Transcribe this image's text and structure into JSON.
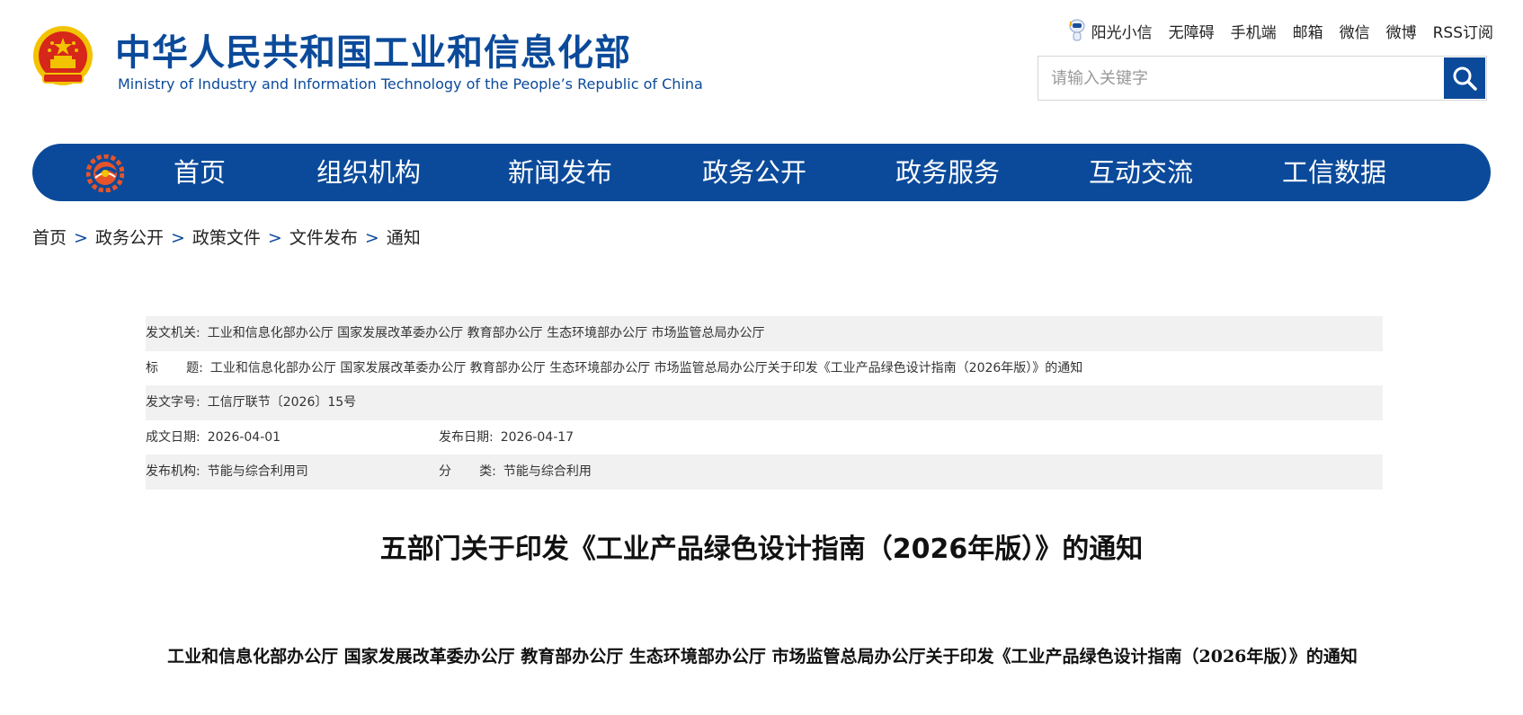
{
  "header": {
    "site_title": "中华人民共和国工业和信息化部",
    "site_subtitle": "Ministry of Industry and Information Technology of the People’s Republic of China",
    "emblem_icon": "national-emblem-icon",
    "top_links": [
      "阳光小信",
      "无障碍",
      "手机端",
      "邮箱",
      "微信",
      "微博",
      "RSS订阅"
    ],
    "search": {
      "placeholder": "请输入关键字",
      "button_icon": "search-icon"
    }
  },
  "nav": {
    "logo_icon": "miit-gear-logo-icon",
    "items": [
      "首页",
      "组织机构",
      "新闻发布",
      "政务公开",
      "政务服务",
      "互动交流",
      "工信数据"
    ]
  },
  "breadcrumb": {
    "items": [
      "首页",
      "政务公开",
      "政策文件",
      "文件发布",
      "通知"
    ],
    "separator": ">"
  },
  "metadata": {
    "issuer": {
      "label": "发文机关:",
      "value": "工业和信息化部办公厅 国家发展改革委办公厅 教育部办公厅 生态环境部办公厅 市场监管总局办公厅"
    },
    "title": {
      "label": "标       题:",
      "value": "工业和信息化部办公厅 国家发展改革委办公厅 教育部办公厅 生态环境部办公厅 市场监管总局办公厅关于印发《工业产品绿色设计指南（2026年版）》的通知"
    },
    "doc_number": {
      "label": "发文字号:",
      "value": "工信厅联节〔2026〕15号"
    },
    "written_date": {
      "label": "成文日期:",
      "value": "2026-04-01"
    },
    "publish_date": {
      "label": "发布日期:",
      "value": "2026-04-17"
    },
    "publisher": {
      "label": "发布机构:",
      "value": "节能与综合利用司"
    },
    "category": {
      "label": "分       类:",
      "value": "节能与综合利用"
    }
  },
  "article": {
    "title": "五部门关于印发《工业产品绿色设计指南（2026年版）》的通知",
    "subtitle": "工业和信息化部办公厅 国家发展改革委办公厅 教育部办公厅 生态环境部办公厅 市场监管总局办公厅关于印发《工业产品绿色设计指南（2026年版）》的通知"
  },
  "colors": {
    "brand_blue": "#0b4a9a",
    "row_shade": "#f1f1f1",
    "emblem_red": "#d7261a",
    "emblem_gold": "#f2c300"
  }
}
